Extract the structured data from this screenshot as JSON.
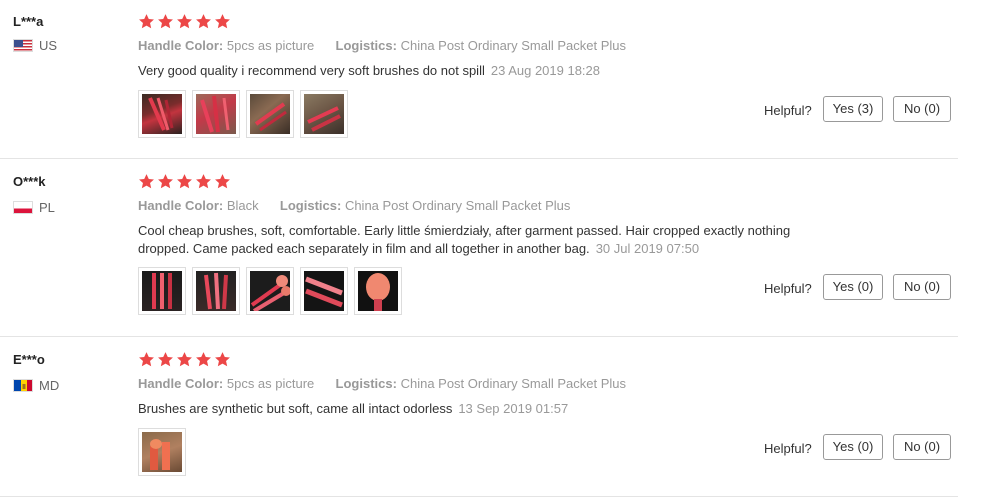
{
  "labels": {
    "attr_name": "Handle Color:",
    "logistics_name": "Logistics:",
    "helpful": "Helpful?"
  },
  "reviews": [
    {
      "user": "L***a",
      "country": "US",
      "stars": 5,
      "handle_color": "5pcs as picture",
      "logistics": "China Post Ordinary Small Packet Plus",
      "text": "Very good quality i recommend very soft brushes do not spill",
      "date": "23 Aug 2019 18:28",
      "photos": [
        "brush-photo",
        "brush-photo",
        "brush-photo",
        "brush-photo"
      ],
      "yes": "Yes (3)",
      "no": "No (0)"
    },
    {
      "user": "O***k",
      "country": "PL",
      "stars": 5,
      "handle_color": "Black",
      "logistics": "China Post Ordinary Small Packet Plus",
      "text": "Cool cheap brushes, soft, comfortable. Early little śmierdziały, after garment passed. Hair cropped exactly nothing dropped. Came packed each separately in film and all together in another bag.",
      "date": "30 Jul 2019 07:50",
      "photos": [
        "brush-photo",
        "brush-photo",
        "brush-photo",
        "brush-photo",
        "brush-photo"
      ],
      "yes": "Yes (0)",
      "no": "No (0)"
    },
    {
      "user": "E***o",
      "country": "MD",
      "stars": 5,
      "handle_color": "5pcs as picture",
      "logistics": "China Post Ordinary Small Packet Plus",
      "text": "Brushes are synthetic but soft, came all intact odorless",
      "date": "13 Sep 2019 01:57",
      "photos": [
        "brush-photo"
      ],
      "yes": "Yes (0)",
      "no": "No (0)"
    }
  ],
  "colors": {
    "star": "#ec4747",
    "muted": "#999999",
    "divider": "#e4e4e4"
  }
}
